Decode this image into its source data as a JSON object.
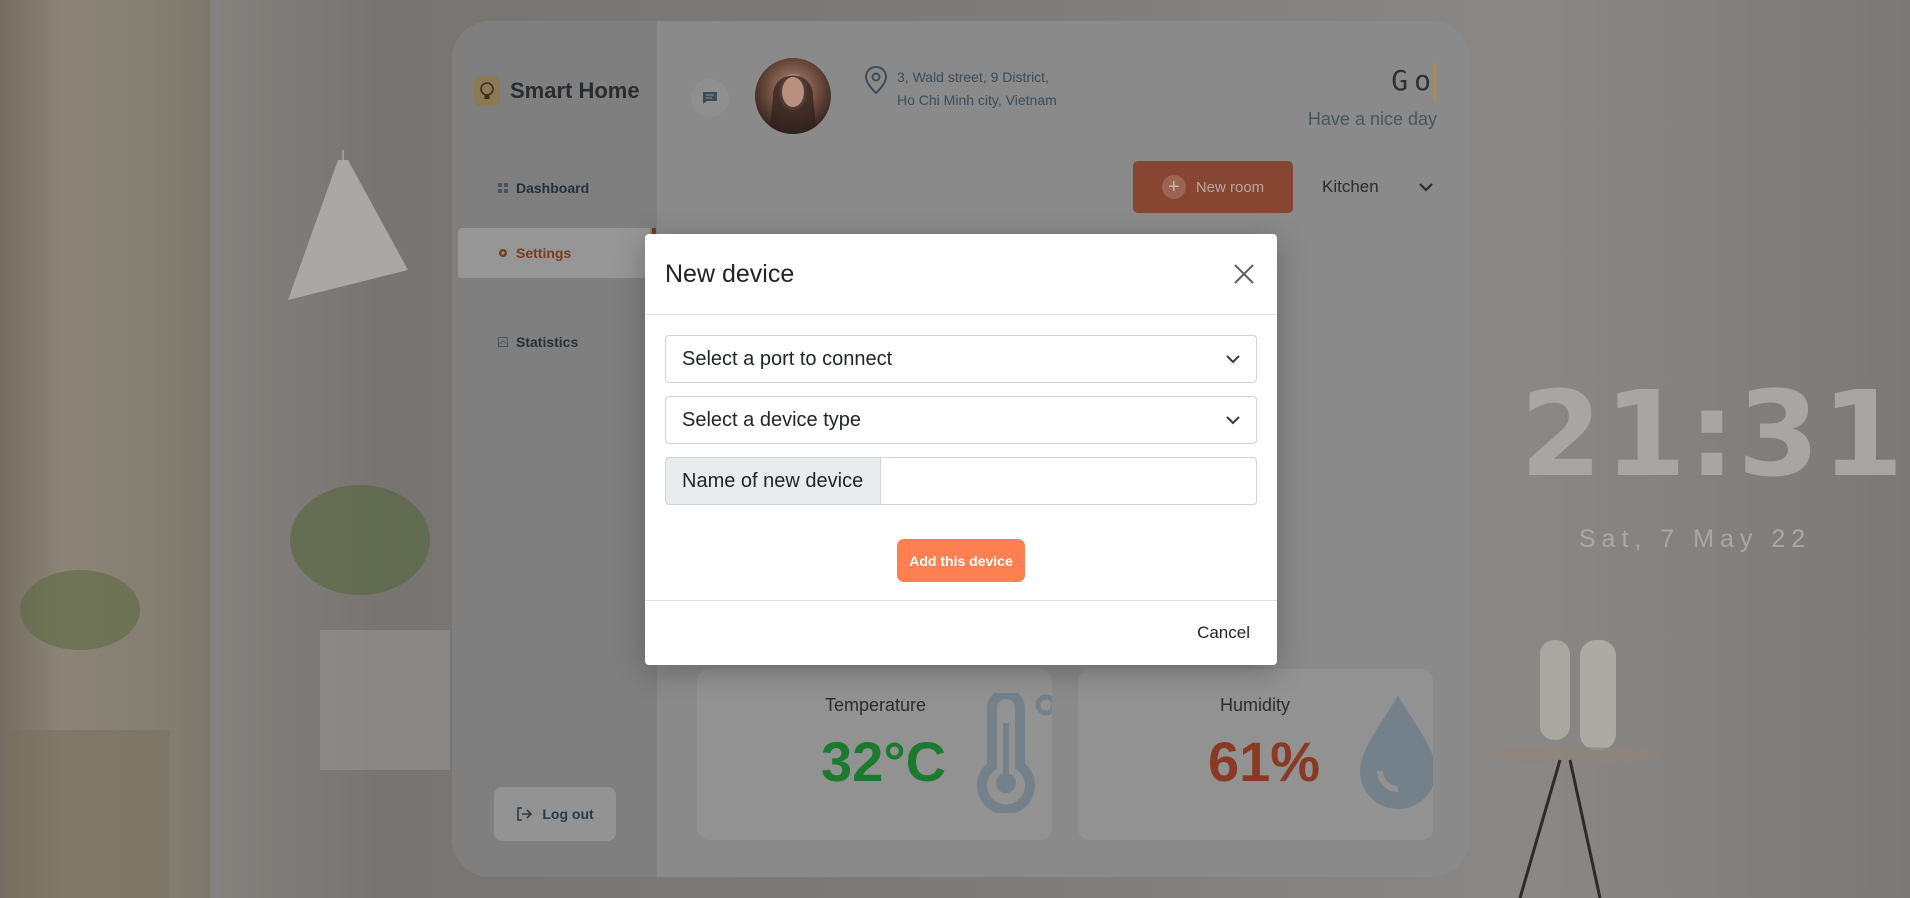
{
  "background": {
    "clock_time": "21:31",
    "clock_date": "Sat, 7 May 22"
  },
  "sidebar": {
    "brand_title": "Smart Home",
    "items": [
      {
        "label": "Dashboard",
        "icon": "grid-icon",
        "active": false
      },
      {
        "label": "Settings",
        "icon": "gear-icon",
        "active": true
      },
      {
        "label": "Statistics",
        "icon": "chart-icon",
        "active": false
      }
    ],
    "logout_label": "Log out"
  },
  "header": {
    "address_line1": "3, Wald street, 9 District,",
    "address_line2": "Ho Chi Minh city, Vietnam",
    "greeting_typed": "Go",
    "subgreeting": "Have a nice day",
    "new_room_label": "New room",
    "room_selected": "Kitchen"
  },
  "cards": {
    "temperature": {
      "title": "Temperature",
      "value": "32°C",
      "color": "#1c7a2e"
    },
    "humidity": {
      "title": "Humidity",
      "value": "61%",
      "color": "#8a3a24"
    }
  },
  "modal": {
    "title": "New device",
    "port_select_placeholder": "Select a port to connect",
    "device_type_placeholder": "Select a device type",
    "name_label": "Name of new device",
    "name_value": "",
    "add_button_label": "Add this device",
    "cancel_label": "Cancel"
  },
  "colors": {
    "accent": "#fe7f4f",
    "brand_dark": "#2a2d30"
  }
}
